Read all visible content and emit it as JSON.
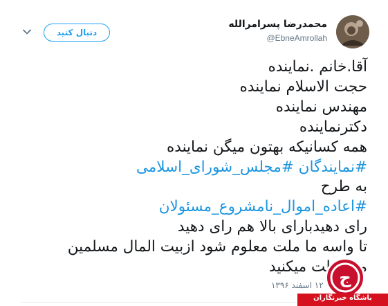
{
  "author": {
    "display_name": "محمدرضا پسرامرالله",
    "handle": "@EbneAmrollah"
  },
  "follow_button_label": "دنبال کنید",
  "tweet": {
    "lines": [
      "آقا.خانم .نماینده",
      "حجت الاسلام نماینده",
      "مهندس نماینده",
      "دکترنماینده",
      "همه کسانیکه بهتون میگن نماینده"
    ],
    "hashtag_line_1": "#نمایندگان #مجلس_شورای_اسلامی",
    "line_after_hashtag_1": "به طرح",
    "hashtag_line_2": "#اعاده_اموال_نامشروع_مسئولان",
    "closing_lines": [
      "رای دهیدبارای بالا هم رای دهید",
      "تا واسه ما ملت معلوم شود ازبیت المال مسلمین",
      "محافظت میکنید"
    ]
  },
  "timestamp": "۱۰:۱ - ۱۲ اسفند ۱۳۹۶",
  "watermark": {
    "text": "باشگاه خبرنگاران",
    "logo_letter": "ج"
  },
  "colors": {
    "accent": "#1da1f2",
    "hashtag": "#1b95e0",
    "watermark_red": "#d5101f"
  },
  "icons": {
    "chevron": "chevron-down-icon",
    "avatar": "avatar"
  }
}
